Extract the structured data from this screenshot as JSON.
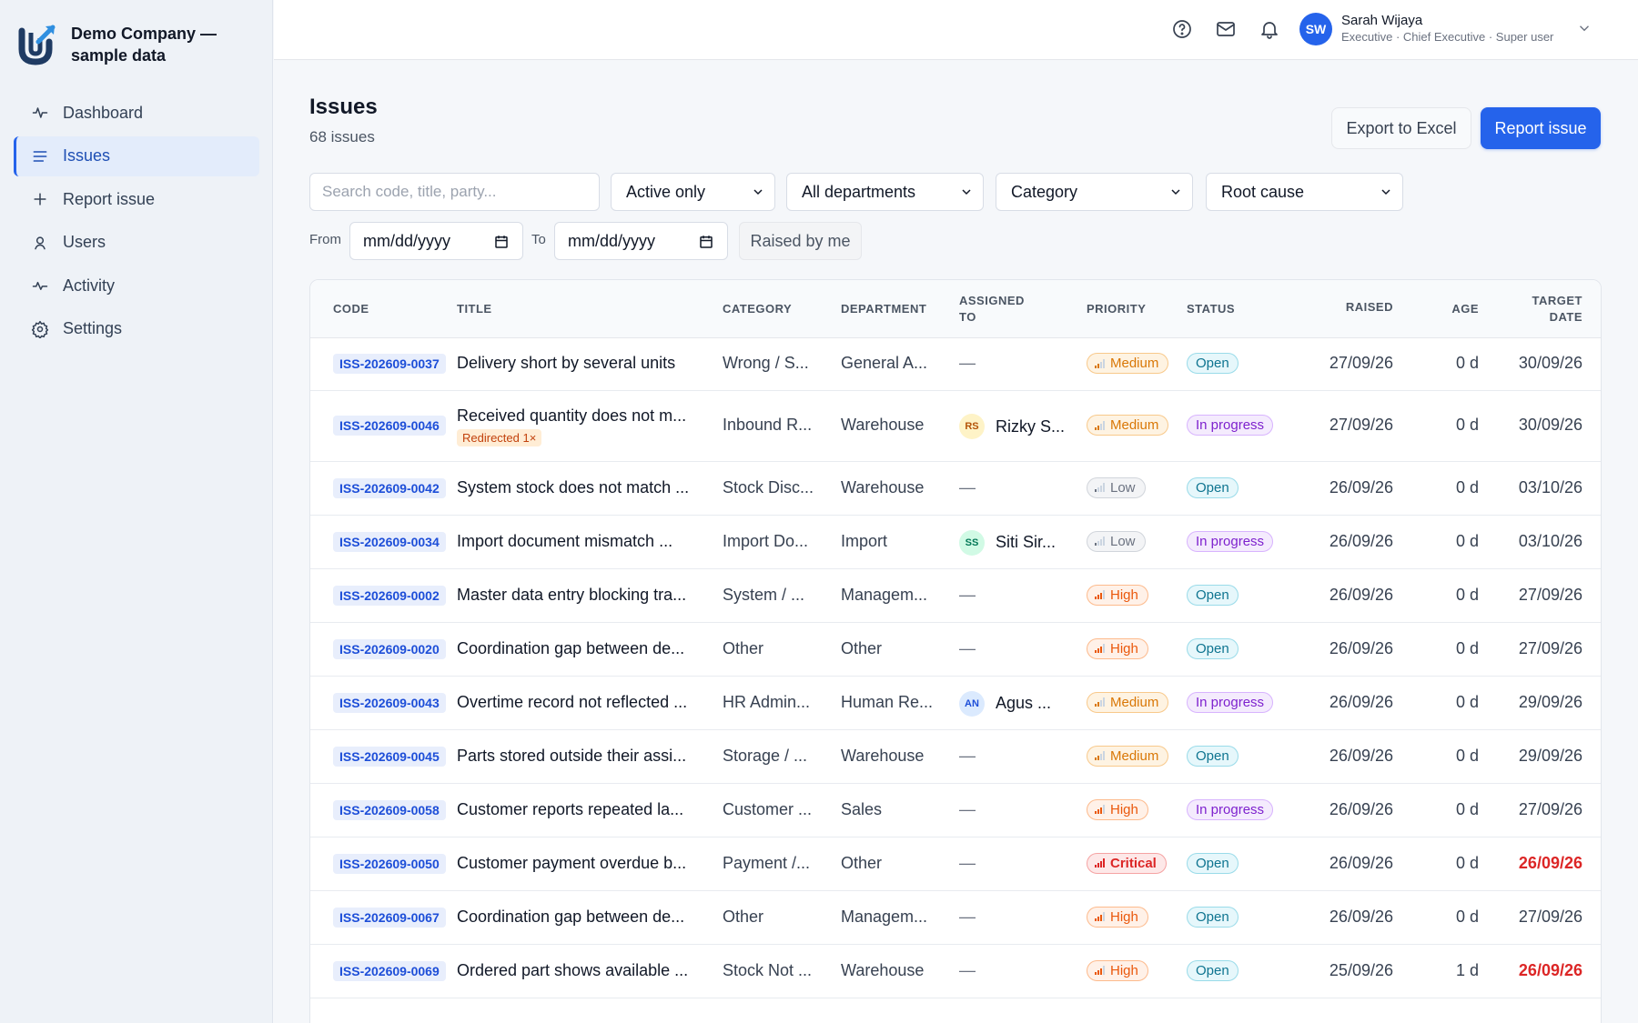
{
  "brand": {
    "name": "Demo Company — sample data",
    "accent": "#2563eb"
  },
  "nav": [
    {
      "label": "Dashboard",
      "icon": "pulse-icon",
      "active": false
    },
    {
      "label": "Issues",
      "icon": "list-icon",
      "active": true
    },
    {
      "label": "Report issue",
      "icon": "plus-icon",
      "active": false
    },
    {
      "label": "Users",
      "icon": "user-icon",
      "active": false
    },
    {
      "label": "Activity",
      "icon": "activity-icon",
      "active": false
    },
    {
      "label": "Settings",
      "icon": "gear-icon",
      "active": false
    }
  ],
  "topbar": {
    "icons": [
      "help-icon",
      "mail-icon",
      "bell-icon"
    ],
    "user": {
      "initials": "SW",
      "name": "Sarah Wijaya",
      "role": "Executive · Chief Executive · Super user"
    }
  },
  "page": {
    "title": "Issues",
    "count": "68 issues"
  },
  "actions": {
    "export": "Export to Excel",
    "report": "Report issue"
  },
  "filters": {
    "search_placeholder": "Search code, title, party...",
    "active": "Active only",
    "department": "All departments",
    "category": "Category",
    "root_cause": "Root cause",
    "from_label": "From",
    "from_value": "mm/dd/yyyy",
    "to_label": "To",
    "to_value": "mm/dd/yyyy",
    "raised_by_me": "Raised by me"
  },
  "table": {
    "headers": {
      "code": "CODE",
      "title": "TITLE",
      "category": "CATEGORY",
      "department": "DEPARTMENT",
      "assigned_1": "ASSIGNED",
      "assigned_2": "TO",
      "priority": "PRIORITY",
      "status": "STATUS",
      "raised": "RAISED",
      "age": "AGE",
      "target_1": "TARGET",
      "target_2": "DATE"
    },
    "rows": [
      {
        "code": "ISS-202609-0037",
        "title": "Delivery short by several units",
        "category": "Wrong / S...",
        "department": "General A...",
        "assignee": "—",
        "priority": "Medium",
        "status": "Open",
        "raised": "27/09/26",
        "age": "0 d",
        "target": "30/09/26",
        "overdue": false
      },
      {
        "code": "ISS-202609-0046",
        "title": "Received quantity does not m...",
        "tag": "Redirected 1×",
        "category": "Inbound R...",
        "department": "Warehouse",
        "assignee_initials": "RS",
        "assignee": "Rizky S...",
        "priority": "Medium",
        "status": "In progress",
        "raised": "27/09/26",
        "age": "0 d",
        "target": "30/09/26",
        "overdue": false
      },
      {
        "code": "ISS-202609-0042",
        "title": "System stock does not match ...",
        "category": "Stock Disc...",
        "department": "Warehouse",
        "assignee": "—",
        "priority": "Low",
        "status": "Open",
        "raised": "26/09/26",
        "age": "0 d",
        "target": "03/10/26",
        "overdue": false
      },
      {
        "code": "ISS-202609-0034",
        "title": "Import document mismatch ...",
        "category": "Import Do...",
        "department": "Import",
        "assignee_initials": "SS",
        "assignee": "Siti Sir...",
        "priority": "Low",
        "status": "In progress",
        "raised": "26/09/26",
        "age": "0 d",
        "target": "03/10/26",
        "overdue": false
      },
      {
        "code": "ISS-202609-0002",
        "title": "Master data entry blocking tra...",
        "category": "System / ...",
        "department": "Managem...",
        "assignee": "—",
        "priority": "High",
        "status": "Open",
        "raised": "26/09/26",
        "age": "0 d",
        "target": "27/09/26",
        "overdue": false
      },
      {
        "code": "ISS-202609-0020",
        "title": "Coordination gap between de...",
        "category": "Other",
        "department": "Other",
        "assignee": "—",
        "priority": "High",
        "status": "Open",
        "raised": "26/09/26",
        "age": "0 d",
        "target": "27/09/26",
        "overdue": false
      },
      {
        "code": "ISS-202609-0043",
        "title": "Overtime record not reflected ...",
        "category": "HR Admin...",
        "department": "Human Re...",
        "assignee_initials": "AN",
        "assignee": "Agus ...",
        "priority": "Medium",
        "status": "In progress",
        "raised": "26/09/26",
        "age": "0 d",
        "target": "29/09/26",
        "overdue": false
      },
      {
        "code": "ISS-202609-0045",
        "title": "Parts stored outside their assi...",
        "category": "Storage / ...",
        "department": "Warehouse",
        "assignee": "—",
        "priority": "Medium",
        "status": "Open",
        "raised": "26/09/26",
        "age": "0 d",
        "target": "29/09/26",
        "overdue": false
      },
      {
        "code": "ISS-202609-0058",
        "title": "Customer reports repeated la...",
        "category": "Customer ...",
        "department": "Sales",
        "assignee": "—",
        "priority": "High",
        "status": "In progress",
        "raised": "26/09/26",
        "age": "0 d",
        "target": "27/09/26",
        "overdue": false
      },
      {
        "code": "ISS-202609-0050",
        "title": "Customer payment overdue b...",
        "category": "Payment /...",
        "department": "Other",
        "assignee": "—",
        "priority": "Critical",
        "status": "Open",
        "raised": "26/09/26",
        "age": "0 d",
        "target": "26/09/26",
        "overdue": true
      },
      {
        "code": "ISS-202609-0067",
        "title": "Coordination gap between de...",
        "category": "Other",
        "department": "Managem...",
        "assignee": "—",
        "priority": "High",
        "status": "Open",
        "raised": "26/09/26",
        "age": "0 d",
        "target": "27/09/26",
        "overdue": false
      },
      {
        "code": "ISS-202609-0069",
        "title": "Ordered part shows available ...",
        "category": "Stock Not ...",
        "department": "Warehouse",
        "assignee": "—",
        "priority": "High",
        "status": "Open",
        "raised": "25/09/26",
        "age": "1 d",
        "target": "26/09/26",
        "overdue": true
      }
    ]
  },
  "colors": {
    "priority": {
      "Low": {
        "fg": "#6b7280",
        "bg": "#f3f4f6",
        "border": "#d1d5db",
        "bars": 1
      },
      "Medium": {
        "fg": "#d97706",
        "bg": "#fef3e2",
        "border": "#f8c98b",
        "bars": 2
      },
      "High": {
        "fg": "#ea580c",
        "bg": "#fff1e8",
        "border": "#fdba8c",
        "bars": 3
      },
      "Critical": {
        "fg": "#dc2626",
        "bg": "#fde8e8",
        "border": "#f5a3a3",
        "bars": 4
      }
    },
    "status": {
      "Open": {
        "fg": "#0e7490",
        "bg": "#e6f7fb",
        "border": "#99dbe9"
      },
      "In progress": {
        "fg": "#7e22ce",
        "bg": "#f4ebfd",
        "border": "#d8b4fe"
      }
    },
    "avatar": {
      "RS": {
        "fg": "#b45309",
        "bg": "#fef3c7"
      },
      "SS": {
        "fg": "#047857",
        "bg": "#d1fae5"
      },
      "AN": {
        "fg": "#1d4ed8",
        "bg": "#dbeafe"
      }
    }
  }
}
